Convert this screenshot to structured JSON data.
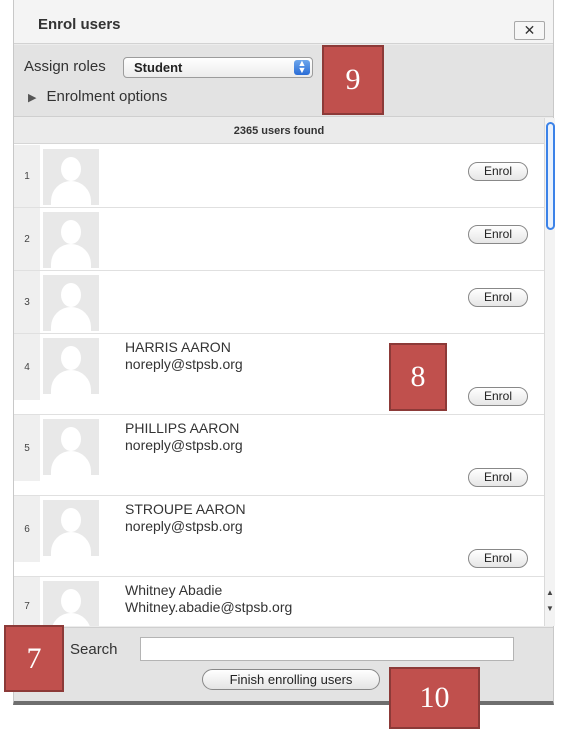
{
  "dialog": {
    "title": "Enrol users",
    "close_label": "✕"
  },
  "roles": {
    "label": "Assign roles",
    "selected": "Student",
    "enrolment_options": "Enrolment options"
  },
  "results": {
    "count_text": "2365 users found",
    "enrol_label": "Enrol",
    "users": [
      {
        "index": "1",
        "name": "",
        "email": ""
      },
      {
        "index": "2",
        "name": "",
        "email": ""
      },
      {
        "index": "3",
        "name": "",
        "email": ""
      },
      {
        "index": "4",
        "name": "HARRIS AARON",
        "email": "noreply@stpsb.org"
      },
      {
        "index": "5",
        "name": "PHILLIPS AARON",
        "email": "noreply@stpsb.org"
      },
      {
        "index": "6",
        "name": "STROUPE AARON",
        "email": "noreply@stpsb.org"
      },
      {
        "index": "7",
        "name": "Whitney Abadie",
        "email": "Whitney.abadie@stpsb.org"
      }
    ]
  },
  "search": {
    "label": "Search",
    "value": ""
  },
  "footer": {
    "finish_label": "Finish enrolling users"
  },
  "callouts": [
    "9",
    "8",
    "7",
    "10"
  ],
  "colors": {
    "callout": "#c0504d",
    "scroll_thumb": "#3b82e8"
  }
}
